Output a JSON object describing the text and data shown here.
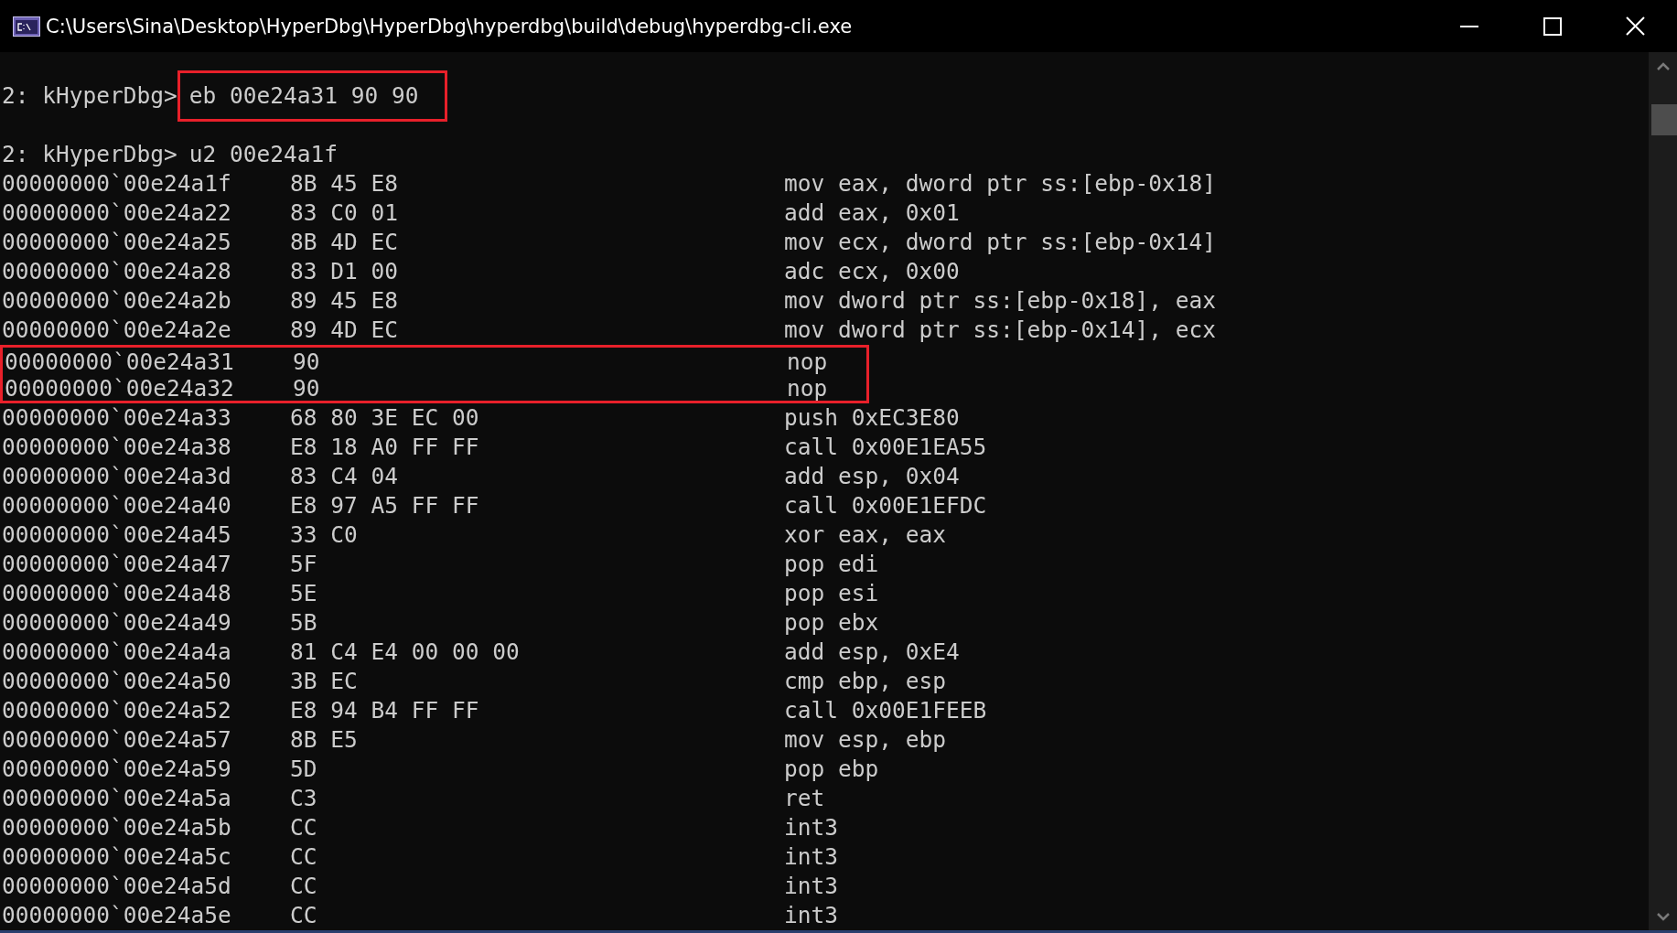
{
  "window": {
    "title": "C:\\Users\\Sina\\Desktop\\HyperDbg\\HyperDbg\\hyperdbg\\build\\debug\\hyperdbg-cli.exe"
  },
  "console": {
    "commands": [
      {
        "prompt": "2: kHyperDbg>",
        "command": "eb 00e24a31 90 90",
        "highlighted": true
      },
      {
        "prompt": "2: kHyperDbg>",
        "command": "u2 00e24a1f",
        "highlighted": false
      }
    ],
    "rows": [
      {
        "address": "00000000`00e24a1f",
        "bytes": "8B 45 E8",
        "instruction": "mov eax, dword ptr ss:[ebp-0x18]",
        "highlighted": false
      },
      {
        "address": "00000000`00e24a22",
        "bytes": "83 C0 01",
        "instruction": "add eax, 0x01",
        "highlighted": false
      },
      {
        "address": "00000000`00e24a25",
        "bytes": "8B 4D EC",
        "instruction": "mov ecx, dword ptr ss:[ebp-0x14]",
        "highlighted": false
      },
      {
        "address": "00000000`00e24a28",
        "bytes": "83 D1 00",
        "instruction": "adc ecx, 0x00",
        "highlighted": false
      },
      {
        "address": "00000000`00e24a2b",
        "bytes": "89 45 E8",
        "instruction": "mov dword ptr ss:[ebp-0x18], eax",
        "highlighted": false
      },
      {
        "address": "00000000`00e24a2e",
        "bytes": "89 4D EC",
        "instruction": "mov dword ptr ss:[ebp-0x14], ecx",
        "highlighted": false
      },
      {
        "address": "00000000`00e24a31",
        "bytes": "90",
        "instruction": "nop",
        "highlighted": true
      },
      {
        "address": "00000000`00e24a32",
        "bytes": "90",
        "instruction": "nop",
        "highlighted": true
      },
      {
        "address": "00000000`00e24a33",
        "bytes": "68 80 3E EC 00",
        "instruction": "push 0xEC3E80",
        "highlighted": false
      },
      {
        "address": "00000000`00e24a38",
        "bytes": "E8 18 A0 FF FF",
        "instruction": "call 0x00E1EA55",
        "highlighted": false
      },
      {
        "address": "00000000`00e24a3d",
        "bytes": "83 C4 04",
        "instruction": "add esp, 0x04",
        "highlighted": false
      },
      {
        "address": "00000000`00e24a40",
        "bytes": "E8 97 A5 FF FF",
        "instruction": "call 0x00E1EFDC",
        "highlighted": false
      },
      {
        "address": "00000000`00e24a45",
        "bytes": "33 C0",
        "instruction": "xor eax, eax",
        "highlighted": false
      },
      {
        "address": "00000000`00e24a47",
        "bytes": "5F",
        "instruction": "pop edi",
        "highlighted": false
      },
      {
        "address": "00000000`00e24a48",
        "bytes": "5E",
        "instruction": "pop esi",
        "highlighted": false
      },
      {
        "address": "00000000`00e24a49",
        "bytes": "5B",
        "instruction": "pop ebx",
        "highlighted": false
      },
      {
        "address": "00000000`00e24a4a",
        "bytes": "81 C4 E4 00 00 00",
        "instruction": "add esp, 0xE4",
        "highlighted": false
      },
      {
        "address": "00000000`00e24a50",
        "bytes": "3B EC",
        "instruction": "cmp ebp, esp",
        "highlighted": false
      },
      {
        "address": "00000000`00e24a52",
        "bytes": "E8 94 B4 FF FF",
        "instruction": "call 0x00E1FEEB",
        "highlighted": false
      },
      {
        "address": "00000000`00e24a57",
        "bytes": "8B E5",
        "instruction": "mov esp, ebp",
        "highlighted": false
      },
      {
        "address": "00000000`00e24a59",
        "bytes": "5D",
        "instruction": "pop ebp",
        "highlighted": false
      },
      {
        "address": "00000000`00e24a5a",
        "bytes": "C3",
        "instruction": "ret",
        "highlighted": false
      },
      {
        "address": "00000000`00e24a5b",
        "bytes": "CC",
        "instruction": "int3",
        "highlighted": false
      },
      {
        "address": "00000000`00e24a5c",
        "bytes": "CC",
        "instruction": "int3",
        "highlighted": false
      },
      {
        "address": "00000000`00e24a5d",
        "bytes": "CC",
        "instruction": "int3",
        "highlighted": false
      },
      {
        "address": "00000000`00e24a5e",
        "bytes": "CC",
        "instruction": "int3",
        "highlighted": false
      }
    ]
  }
}
